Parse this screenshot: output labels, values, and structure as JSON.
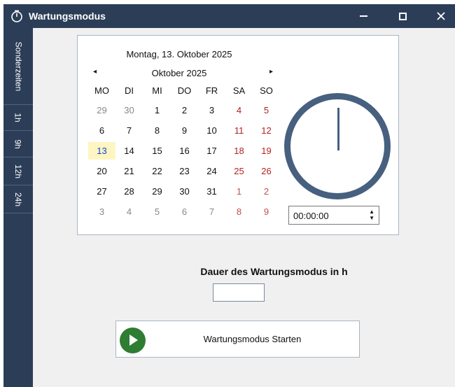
{
  "window": {
    "title": "Wartungsmodus",
    "icon": "timer-icon",
    "controls": {
      "minimize": "minimize-icon",
      "maximize": "maximize-icon",
      "close": "close-icon"
    }
  },
  "sidebar": {
    "items": [
      {
        "label": "Sonderzeiten"
      },
      {
        "label": "1h"
      },
      {
        "label": "9h"
      },
      {
        "label": "12h"
      },
      {
        "label": "24h"
      }
    ]
  },
  "calendar": {
    "header": "Montag, 13. Oktober 2025",
    "month_label": "Oktober 2025",
    "prev": "◂",
    "next": "▸",
    "weekdays": [
      "MO",
      "DI",
      "MI",
      "DO",
      "FR",
      "SA",
      "SO"
    ],
    "weeks": [
      [
        "29",
        "30",
        "1",
        "2",
        "3",
        "4",
        "5"
      ],
      [
        "6",
        "7",
        "8",
        "9",
        "10",
        "11",
        "12"
      ],
      [
        "13",
        "14",
        "15",
        "16",
        "17",
        "18",
        "19"
      ],
      [
        "20",
        "21",
        "22",
        "23",
        "24",
        "25",
        "26"
      ],
      [
        "27",
        "28",
        "29",
        "30",
        "31",
        "1",
        "2"
      ],
      [
        "3",
        "4",
        "5",
        "6",
        "7",
        "8",
        "9"
      ]
    ],
    "selected_day": "13"
  },
  "time": {
    "value": "00:00:00",
    "spin_up": "▲",
    "spin_down": "▼"
  },
  "duration": {
    "label": "Dauer des Wartungsmodus in h",
    "value": ""
  },
  "start_button": {
    "label": "Wartungsmodus Starten",
    "icon": "play-icon"
  },
  "colors": {
    "titlebar": "#2c3e57",
    "clock": "#47607f",
    "weekend": "#b22222",
    "today_bg": "#fdf6c3",
    "play": "#2e7d32"
  }
}
